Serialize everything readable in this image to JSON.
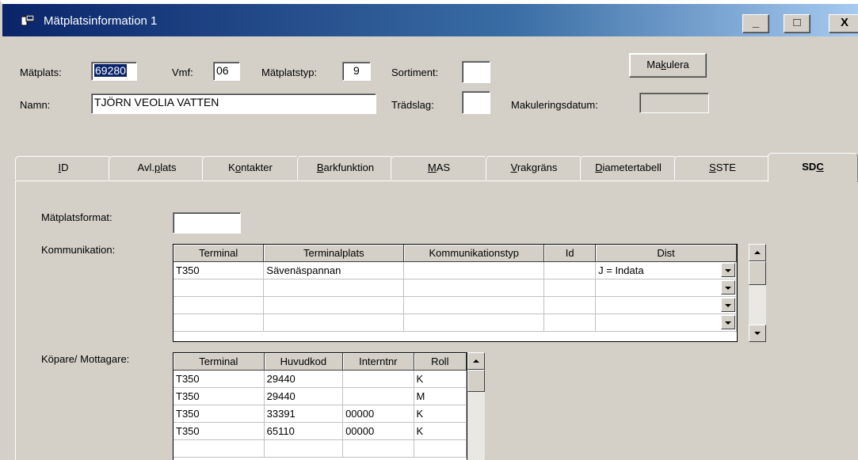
{
  "window": {
    "title": "Mätplatsinformation 1",
    "minimize": "_",
    "maximize": "□",
    "close": "X"
  },
  "header": {
    "matplats_label": "Mätplats:",
    "matplats_value": "69280",
    "vmf_label": "Vmf:",
    "vmf_value": "06",
    "matplatstyp_label": "Mätplatstyp:",
    "matplatstyp_value": "9",
    "sortiment_label": "Sortiment:",
    "sortiment_value": "",
    "makulera_pre": "Ma",
    "makulera_u": "k",
    "makulera_post": "ulera",
    "namn_label": "Namn:",
    "namn_value": "TJÖRN VEOLIA VATTEN",
    "tradslag_label": "Trädslag:",
    "tradslag_value": "",
    "makuleringsdatum_label": "Makuleringsdatum:",
    "makuleringsdatum_value": ""
  },
  "tabs": [
    {
      "pre": "",
      "u": "I",
      "post": "D"
    },
    {
      "pre": "Avl.",
      "u": "p",
      "post": "lats"
    },
    {
      "pre": "K",
      "u": "o",
      "post": "ntakter"
    },
    {
      "pre": "",
      "u": "B",
      "post": "arkfunktion"
    },
    {
      "pre": "",
      "u": "M",
      "post": "AS"
    },
    {
      "pre": "",
      "u": "V",
      "post": "rakgräns"
    },
    {
      "pre": "",
      "u": "D",
      "post": "iametertabell"
    },
    {
      "pre": "",
      "u": "S",
      "post": "STE"
    },
    {
      "pre": "SD",
      "u": "C",
      "post": ""
    }
  ],
  "sdc": {
    "matplatsformat_label": "Mätplatsformat:",
    "matplatsformat_value": "",
    "kommunikation_label": "Kommunikation:",
    "kommunikation_columns": [
      "Terminal",
      "Terminalplats",
      "Kommunikationstyp",
      "Id",
      "Dist"
    ],
    "kommunikation_rows": [
      [
        "T350",
        "Sävenäspannan",
        "",
        "",
        "J = Indata"
      ],
      [
        "",
        "",
        "",
        "",
        ""
      ],
      [
        "",
        "",
        "",
        "",
        ""
      ],
      [
        "",
        "",
        "",
        "",
        ""
      ]
    ],
    "kopare_label": "Köpare/ Mottagare:",
    "kopare_columns": [
      "Terminal",
      "Huvudkod",
      "Interntnr",
      "Roll"
    ],
    "kopare_rows": [
      [
        "T350",
        "29440",
        "",
        "K"
      ],
      [
        "T350",
        "29440",
        "",
        "M"
      ],
      [
        "T350",
        "33391",
        "00000",
        "K"
      ],
      [
        "T350",
        "65110",
        "00000",
        "K"
      ],
      [
        "",
        "",
        "",
        ""
      ]
    ]
  },
  "colors": {
    "title_bar_start": "#0a246a",
    "title_bar_end": "#a6caf0",
    "dialog_bg": "#d4d0c8",
    "selection": "#0a246a"
  }
}
